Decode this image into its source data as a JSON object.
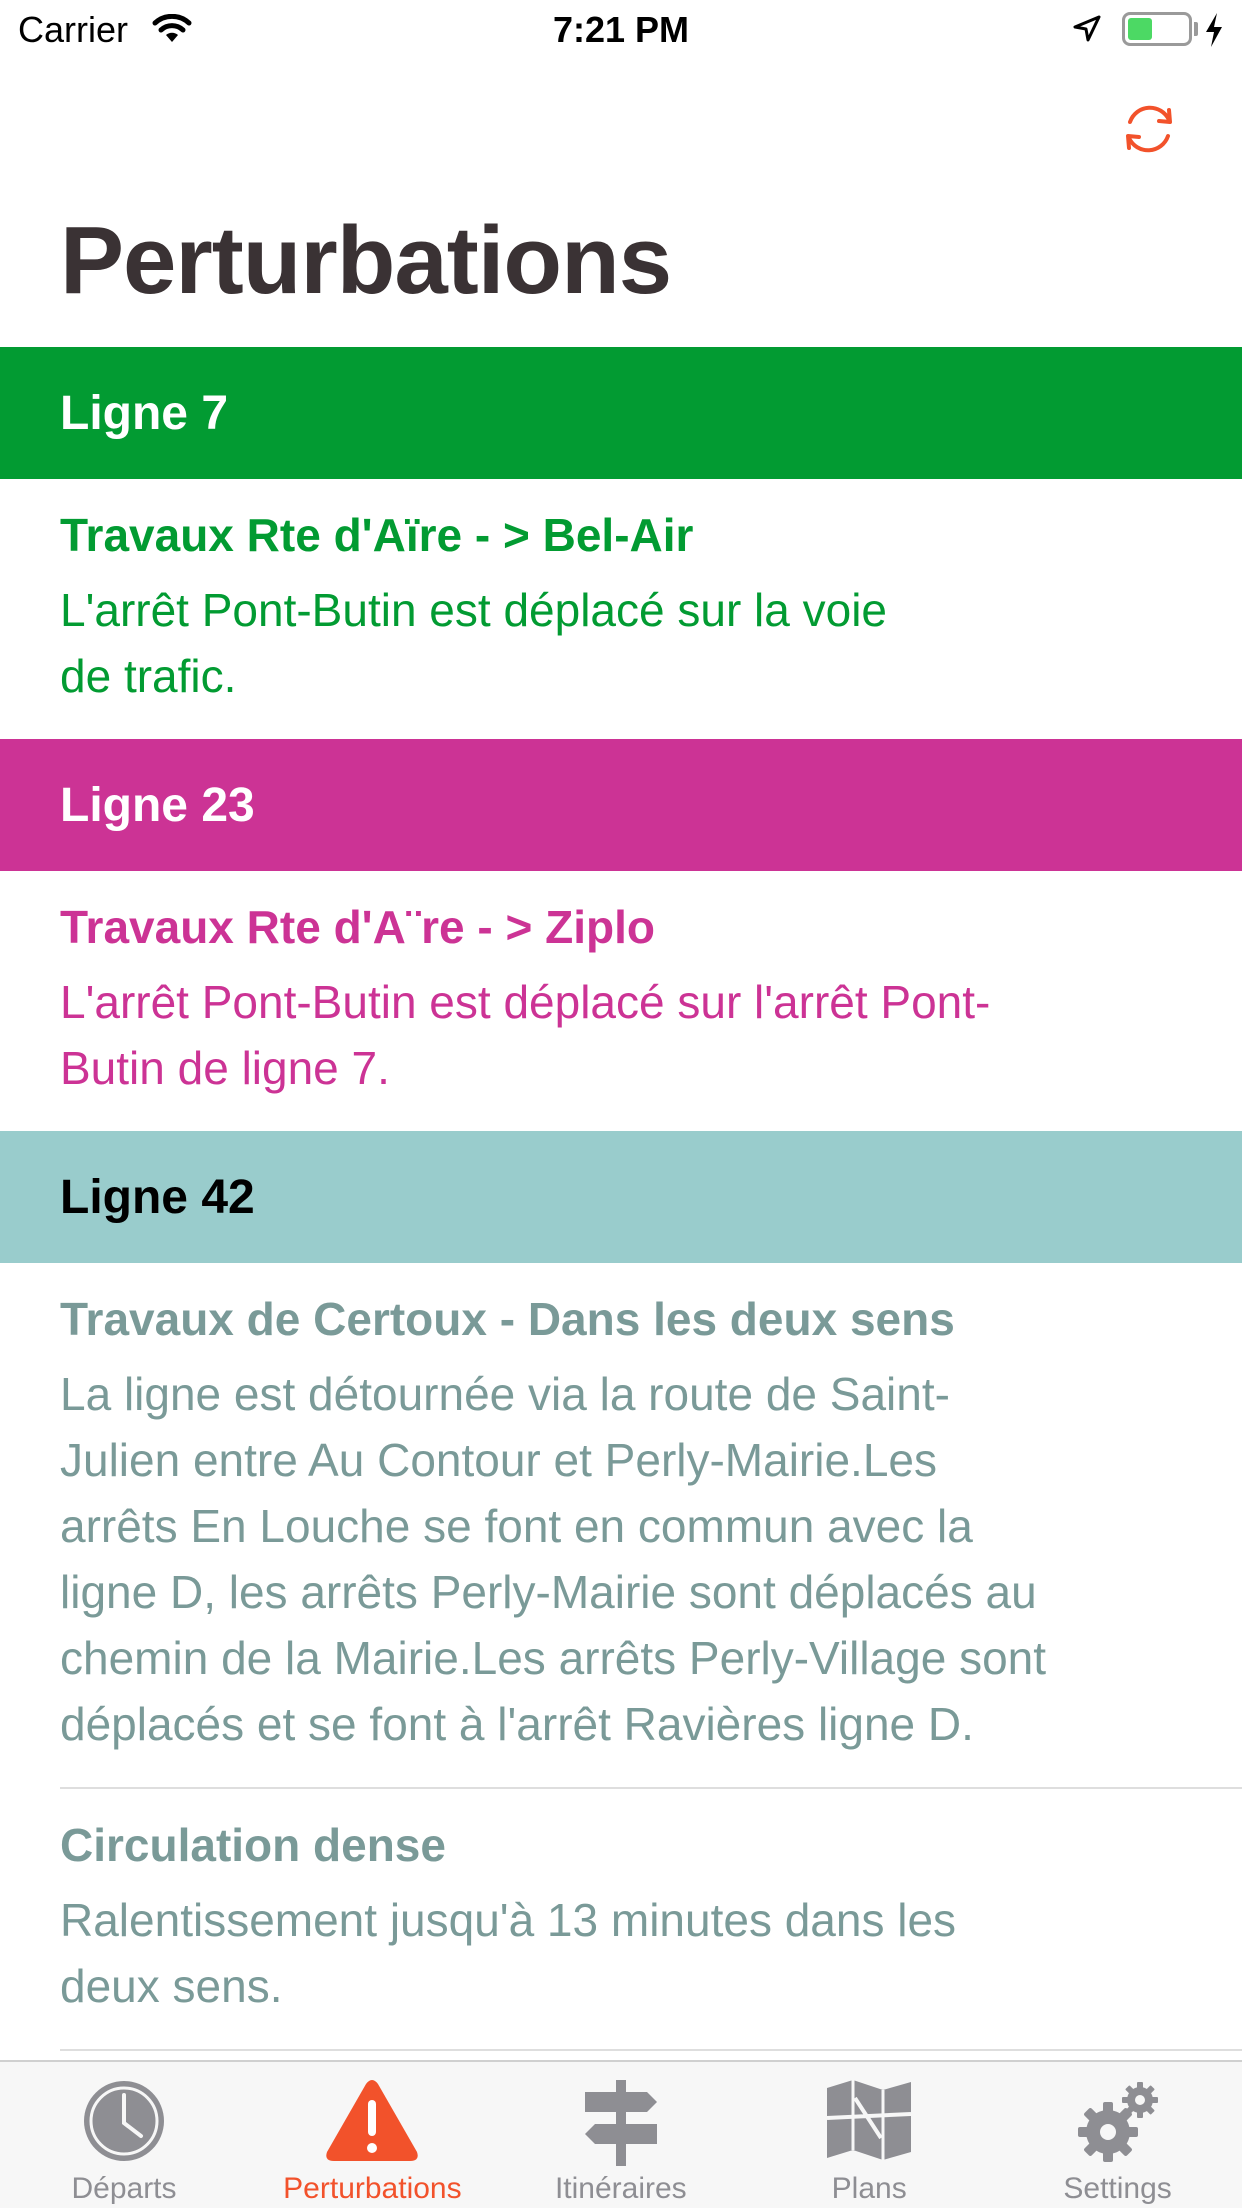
{
  "status_bar": {
    "carrier": "Carrier",
    "time": "7:21 PM"
  },
  "header": {
    "title": "Perturbations",
    "refresh_icon": "refresh-icon"
  },
  "lines": [
    {
      "name": "Ligne 7",
      "color": "#029b32",
      "header_text_color": "#ffffff",
      "text_color": "#029b32",
      "items": [
        {
          "title": "Travaux Rte d'Aïre - > Bel-Air",
          "description_lines": [
            "L'arrêt Pont-Butin est déplacé sur la voie",
            "de trafic."
          ]
        }
      ]
    },
    {
      "name": "Ligne 23",
      "color": "#cc3395",
      "header_text_color": "#ffffff",
      "text_color": "#cc3395",
      "items": [
        {
          "title": "Travaux Rte d'A¨re - > Ziplo",
          "description_lines": [
            "L'arrêt Pont-Butin est déplacé sur l'arrêt Pont-",
            "Butin de ligne 7."
          ]
        }
      ]
    },
    {
      "name": "Ligne 42",
      "color": "#99cccc",
      "header_text_color": "#000000",
      "text_color": "#7a9a98",
      "items": [
        {
          "title": "Travaux de Certoux - Dans les deux sens",
          "description_lines": [
            "La ligne est détournée via la route de Saint-",
            "Julien entre Au Contour et Perly-Mairie.Les",
            "arrêts En Louche se font en commun avec la",
            "ligne D, les arrêts Perly-Mairie sont déplacés au",
            "chemin de la Mairie.Les arrêts Perly-Village sont",
            "déplacés et se font à l'arrêt Ravières ligne D."
          ]
        },
        {
          "title": "Circulation dense",
          "description_lines": [
            "Ralentissement jusqu'à 13 minutes dans les",
            "deux sens."
          ]
        }
      ]
    }
  ],
  "tab_bar": {
    "tabs": [
      {
        "label": "Départs",
        "icon": "clock-icon",
        "active": false
      },
      {
        "label": "Perturbations",
        "icon": "warning-icon",
        "active": true
      },
      {
        "label": "Itinéraires",
        "icon": "signpost-icon",
        "active": false
      },
      {
        "label": "Plans",
        "icon": "map-icon",
        "active": false
      },
      {
        "label": "Settings",
        "icon": "gears-icon",
        "active": false
      }
    ],
    "active_color": "#f2522b",
    "inactive_color": "#8e8e93"
  }
}
